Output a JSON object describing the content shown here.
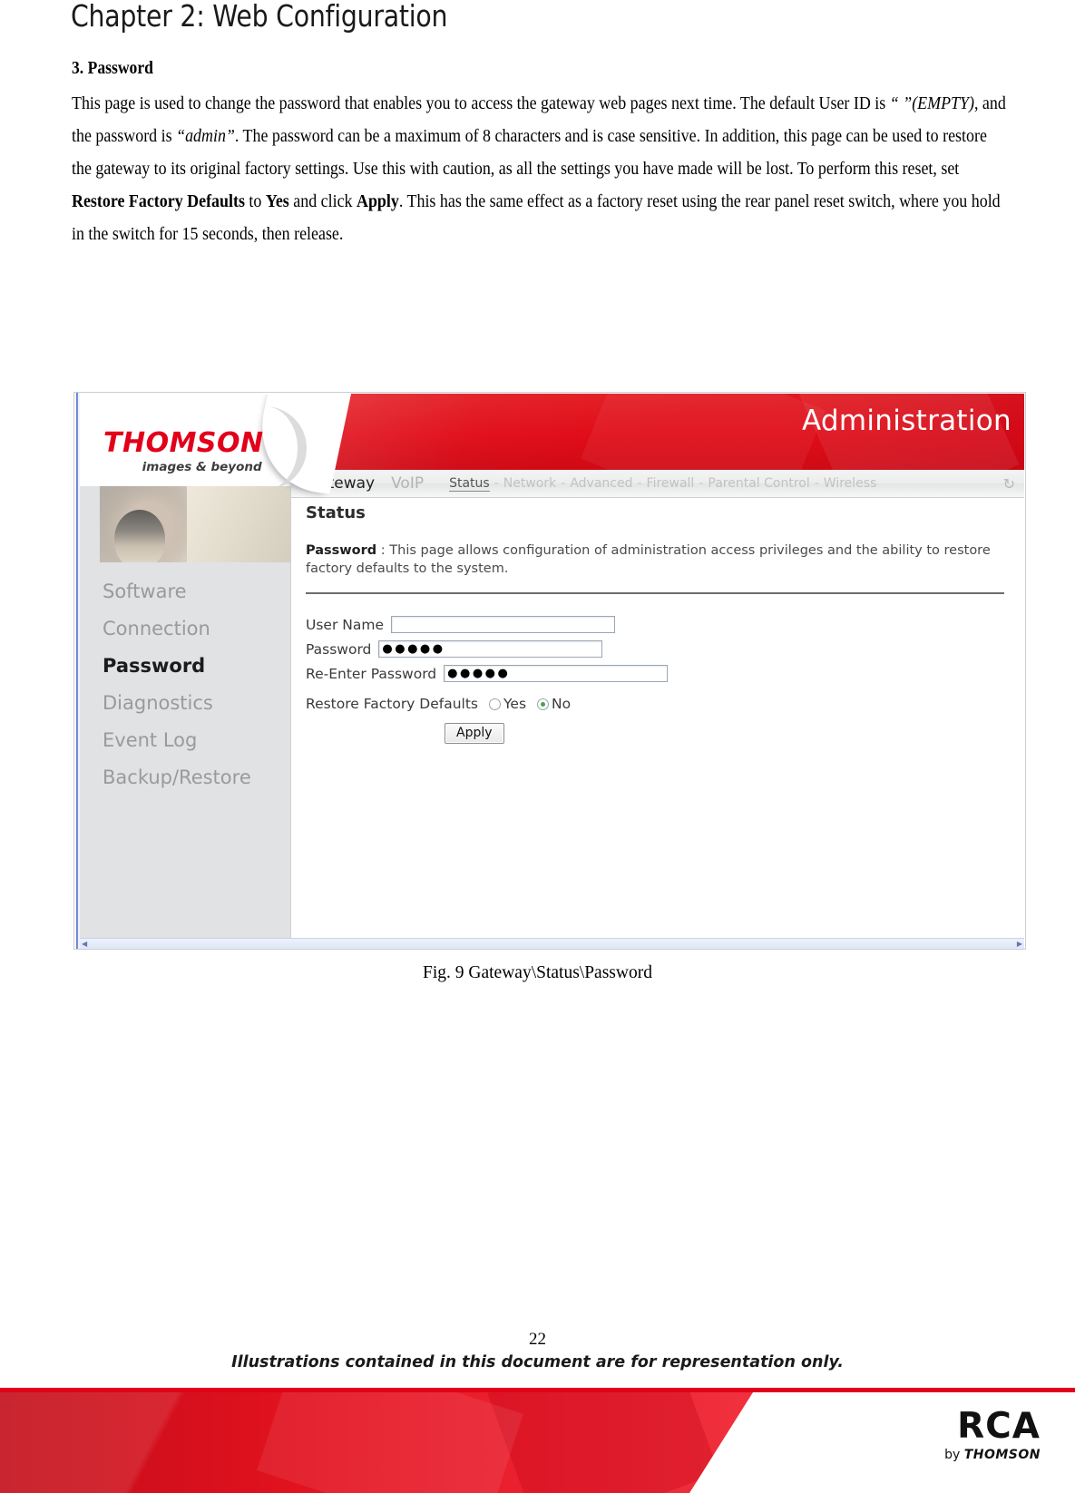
{
  "document": {
    "chapter_title": "Chapter 2: Web Configuration",
    "section_heading": "3. Password",
    "paragraph_parts": {
      "p1": "This page is used to change the password that enables you to access the gateway web pages next time. The default User ID is ",
      "empty_quote": "“ ”(EMPTY)",
      "p2": ", and the password is ",
      "admin_quote": "“admin”",
      "p3": ". The password can be a maximum of 8 characters and is case sensitive. In addition, this page can be used to restore the gateway to its original factory settings. Use this with caution, as all the settings you have made will be lost. To perform this reset, set ",
      "restore_bold": "Restore Factory Defaults",
      "p4": " to ",
      "yes_bold": "Yes",
      "p5": " and click ",
      "apply_bold": "Apply",
      "p6": ". This has the same effect as a factory reset using the rear panel reset switch, where you hold in the switch for 15 seconds, then release."
    },
    "figure_caption": "Fig. 9 Gateway\\Status\\Password",
    "page_number": "22",
    "footer_note": "Illustrations contained in this document are for representation only.",
    "brand": {
      "name": "RCA",
      "by_prefix": "by ",
      "by_brand": "THOMSON"
    }
  },
  "screenshot": {
    "logo": {
      "wordmark": "THOMSON",
      "tagline": "images & beyond"
    },
    "banner_title": "Administration",
    "nav_primary": [
      {
        "label": "Gateway",
        "active": true
      },
      {
        "label": "VoIP",
        "active": false
      }
    ],
    "nav_secondary": [
      {
        "label": "Status",
        "active": true
      },
      {
        "label": "Network",
        "active": false
      },
      {
        "label": "Advanced",
        "active": false
      },
      {
        "label": "Firewall",
        "active": false
      },
      {
        "label": "Parental Control",
        "active": false
      },
      {
        "label": "Wireless",
        "active": false
      }
    ],
    "nav_separator": "-",
    "refresh_icon": "↻",
    "sidebar": {
      "items": [
        {
          "label": "Software",
          "active": false
        },
        {
          "label": "Connection",
          "active": false
        },
        {
          "label": "Password",
          "active": true
        },
        {
          "label": "Diagnostics",
          "active": false
        },
        {
          "label": "Event Log",
          "active": false
        },
        {
          "label": "Backup/Restore",
          "active": false
        }
      ]
    },
    "content": {
      "page_heading": "Status",
      "desc_label": "Password",
      "desc_separator": " :  ",
      "desc_text": "This page allows configuration of administration access privileges and the ability to restore factory defaults to the system.",
      "fields": [
        {
          "label": "User Name",
          "value": "",
          "masked": false
        },
        {
          "label": "Password",
          "value": "●●●●●",
          "masked": true
        },
        {
          "label": "Re-Enter Password",
          "value": "●●●●●",
          "masked": true
        }
      ],
      "restore": {
        "label": "Restore Factory Defaults",
        "options": [
          {
            "label": "Yes",
            "selected": false
          },
          {
            "label": "No",
            "selected": true
          }
        ]
      },
      "apply_label": "Apply"
    },
    "scrollbar": {
      "left_arrow": "◀",
      "right_arrow": "▶"
    }
  },
  "colors": {
    "brand_red": "#e2001a",
    "banner_red": "#e00c18",
    "sidebar_bg": "#e1e2e4",
    "radio_selected": "#4aa14a"
  }
}
